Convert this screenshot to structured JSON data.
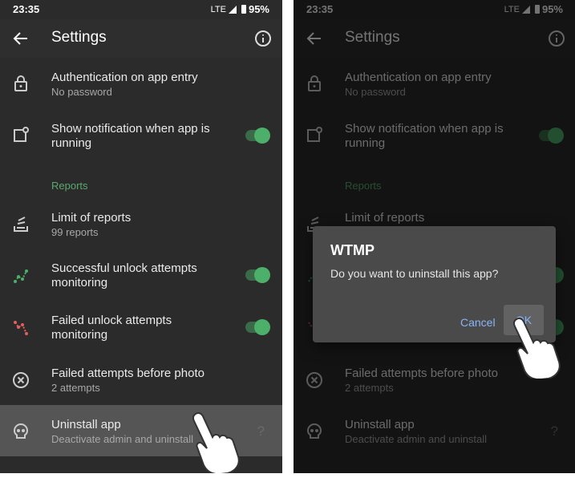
{
  "status": {
    "time": "23:35",
    "network": "LTE",
    "battery": "95%"
  },
  "appbar": {
    "title": "Settings"
  },
  "items": [
    {
      "title": "Authentication on app entry",
      "subtitle": "No password"
    },
    {
      "title": "Show notification when app is running"
    },
    {
      "title": "Limit of reports",
      "subtitle": "99 reports"
    },
    {
      "title": "Successful unlock attempts monitoring"
    },
    {
      "title": "Failed unlock attempts monitoring"
    },
    {
      "title": "Failed attempts before photo",
      "subtitle": "2 attempts"
    },
    {
      "title": "Uninstall app",
      "subtitle": "Deactivate admin and uninstall"
    }
  ],
  "section": {
    "reports": "Reports"
  },
  "help": "?",
  "dialog": {
    "title": "WTMP",
    "message": "Do you want to uninstall this app?",
    "cancel": "Cancel",
    "ok": "OK"
  },
  "colors": {
    "accent": "#4caf6a",
    "section": "#5aa870",
    "dialog_button": "#8ab4f8"
  },
  "icons": [
    "back-arrow-icon",
    "info-icon",
    "lock-icon",
    "notification-icon",
    "reports-stack-icon",
    "success-graph-icon",
    "failed-graph-icon",
    "cancel-circle-icon",
    "skull-icon",
    "pointing-hand-icon"
  ]
}
